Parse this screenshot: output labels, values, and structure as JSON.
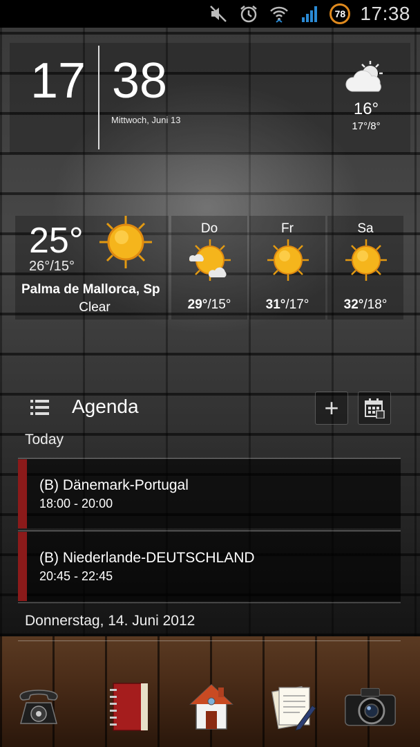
{
  "status_bar": {
    "time": "17:38",
    "battery_level": "78",
    "icons": [
      "mute-icon",
      "alarm-icon",
      "wifi-icon",
      "signal-icon"
    ]
  },
  "clock": {
    "hour": "17",
    "minute": "38",
    "date": "Mittwoch, Juni 13",
    "current_temp": "16°",
    "range": "17°/8°",
    "icon": "partly-cloudy-icon"
  },
  "weather": {
    "temp": "25°",
    "range": "26°/15°",
    "city": "Palma de Mallorca, Sp",
    "condition": "Clear",
    "icon": "sun-icon",
    "forecast": [
      {
        "day": "Do",
        "high": "29°",
        "low": "/15°",
        "icon": "sun-cloud-icon"
      },
      {
        "day": "Fr",
        "high": "31°",
        "low": "/17°",
        "icon": "sun-icon"
      },
      {
        "day": "Sa",
        "high": "32°",
        "low": "/18°",
        "icon": "sun-icon"
      }
    ]
  },
  "agenda": {
    "title": "Agenda",
    "add_label": "+",
    "today_label": "Today",
    "events": [
      {
        "title": "(B) Dänemark-Portugal",
        "time": "18:00 - 20:00"
      },
      {
        "title": "(B) Niederlande-DEUTSCHLAND",
        "time": "20:45 - 22:45"
      }
    ],
    "next_day_label": "Donnerstag, 14. Juni 2012"
  },
  "dock": {
    "items": [
      "phone-icon",
      "contacts-book-icon",
      "home-icon",
      "notes-icon",
      "camera-icon"
    ]
  },
  "colors": {
    "event_accent": "#8b1a1a",
    "battery_ring": "#e08a1e",
    "sun": "#f5b51c"
  }
}
